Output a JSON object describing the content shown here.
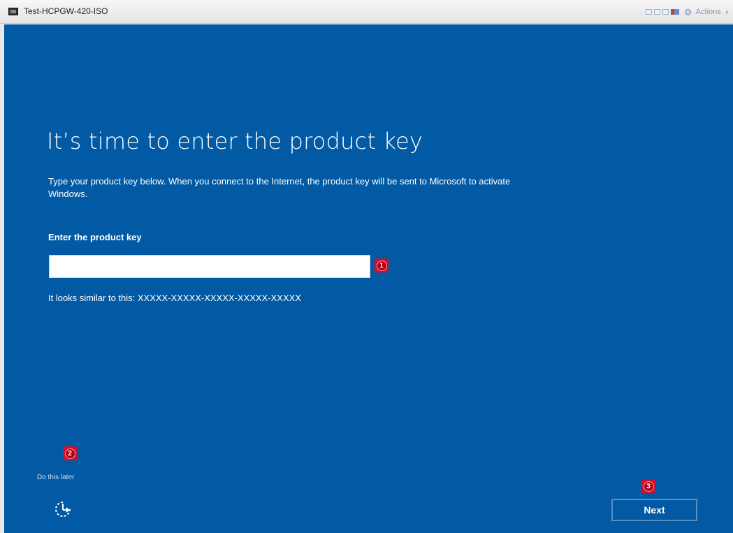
{
  "window": {
    "title": "Test-HCPGW-420-ISO",
    "actions_label": "Actions"
  },
  "screen": {
    "title": "It’s time to enter the product key",
    "description": "Type your product key below. When you connect to the Internet, the product key will be sent to Microsoft to activate Windows.",
    "field_label": "Enter the product key",
    "key_value": "",
    "hint": "It looks similar to this: XXXXX-XXXXX-XXXXX-XXXXX-XXXXX",
    "later_link": "Do this later",
    "next_label": "Next"
  },
  "markers": [
    "1",
    "2",
    "3"
  ],
  "colors": {
    "background": "#015aa3",
    "marker": "#d0112b"
  },
  "icons": {
    "vm": "monitor-icon",
    "gear": "gear-icon",
    "ease_of_access": "ease-of-access-icon"
  }
}
